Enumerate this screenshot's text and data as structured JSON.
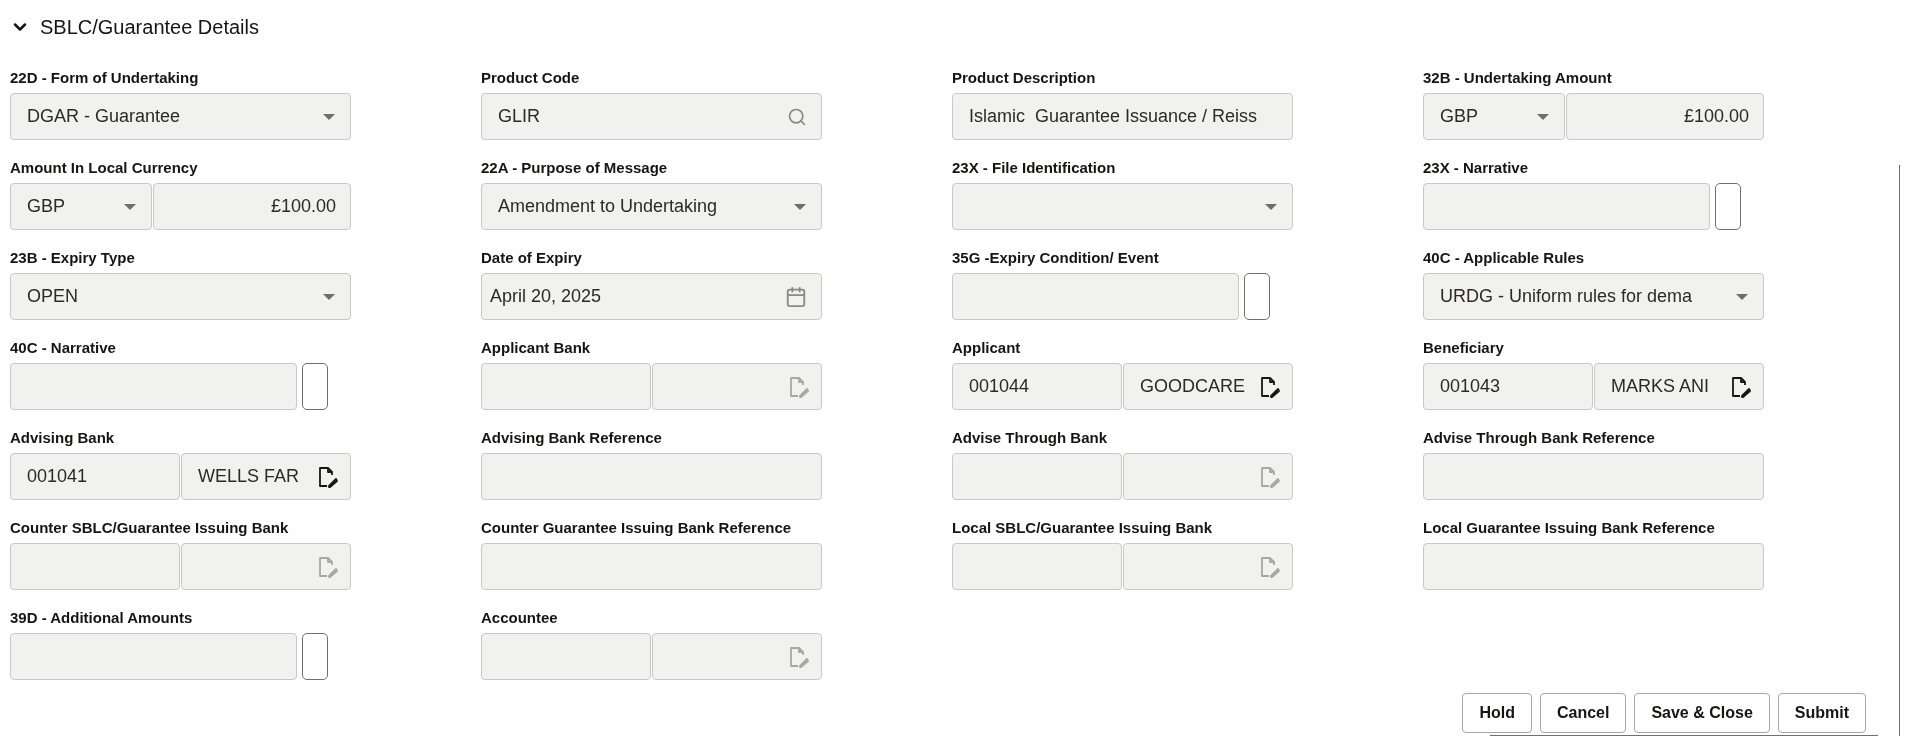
{
  "section": {
    "title": "SBLC/Guarantee Details",
    "expanded": true
  },
  "fields": [
    {
      "label": "22D - Form of Undertaking",
      "kind": "select",
      "value": "DGAR - Guarantee"
    },
    {
      "label": "Product Code",
      "kind": "search",
      "value": "GLIR"
    },
    {
      "label": "Product Description",
      "kind": "text",
      "value": "Islamic  Guarantee Issuance / Reiss"
    },
    {
      "label": "32B - Undertaking Amount",
      "kind": "amount",
      "currency": "GBP",
      "amount": "£100.00"
    },
    {
      "label": "Amount In Local Currency",
      "kind": "amount",
      "currency": "GBP",
      "amount": "£100.00"
    },
    {
      "label": "22A - Purpose of Message",
      "kind": "select",
      "value": "Amendment to Undertaking"
    },
    {
      "label": "23X - File Identification",
      "kind": "select"
    },
    {
      "label": "23X - Narrative",
      "kind": "narrative"
    },
    {
      "label": "23B - Expiry Type",
      "kind": "select",
      "value": "OPEN"
    },
    {
      "label": "Date of Expiry",
      "kind": "date",
      "value": "April 20, 2025"
    },
    {
      "label": "35G -Expiry Condition/ Event",
      "kind": "narrative"
    },
    {
      "label": "40C - Applicable Rules",
      "kind": "select",
      "value": "URDG - Uniform rules for dema"
    },
    {
      "label": "40C - Narrative",
      "kind": "narrative"
    },
    {
      "label": "Applicant Bank",
      "kind": "lookup",
      "disabled": true
    },
    {
      "label": "Applicant",
      "kind": "lookup",
      "code": "001044",
      "name": "GOODCARE",
      "disabled": false
    },
    {
      "label": "Beneficiary",
      "kind": "lookup",
      "code": "001043",
      "name": "MARKS ANI",
      "disabled": false
    },
    {
      "label": "Advising Bank",
      "kind": "lookup",
      "code": "001041",
      "name": "WELLS FAR",
      "disabled": false
    },
    {
      "label": "Advising Bank Reference",
      "kind": "text"
    },
    {
      "label": "Advise Through Bank",
      "kind": "lookup",
      "disabled": true
    },
    {
      "label": "Advise Through Bank Reference",
      "kind": "text"
    },
    {
      "label": "Counter SBLC/Guarantee Issuing Bank",
      "kind": "lookup",
      "disabled": true
    },
    {
      "label": "Counter Guarantee Issuing Bank Reference",
      "kind": "text"
    },
    {
      "label": "Local SBLC/Guarantee Issuing Bank",
      "kind": "lookup",
      "disabled": true
    },
    {
      "label": "Local Guarantee Issuing Bank Reference",
      "kind": "text"
    },
    {
      "label": "39D - Additional Amounts",
      "kind": "narrative"
    },
    {
      "label": "Accountee",
      "kind": "lookup",
      "disabled": true
    }
  ],
  "buttons": [
    {
      "label": "Hold"
    },
    {
      "label": "Cancel"
    },
    {
      "label": "Save & Close"
    },
    {
      "label": "Submit"
    }
  ]
}
